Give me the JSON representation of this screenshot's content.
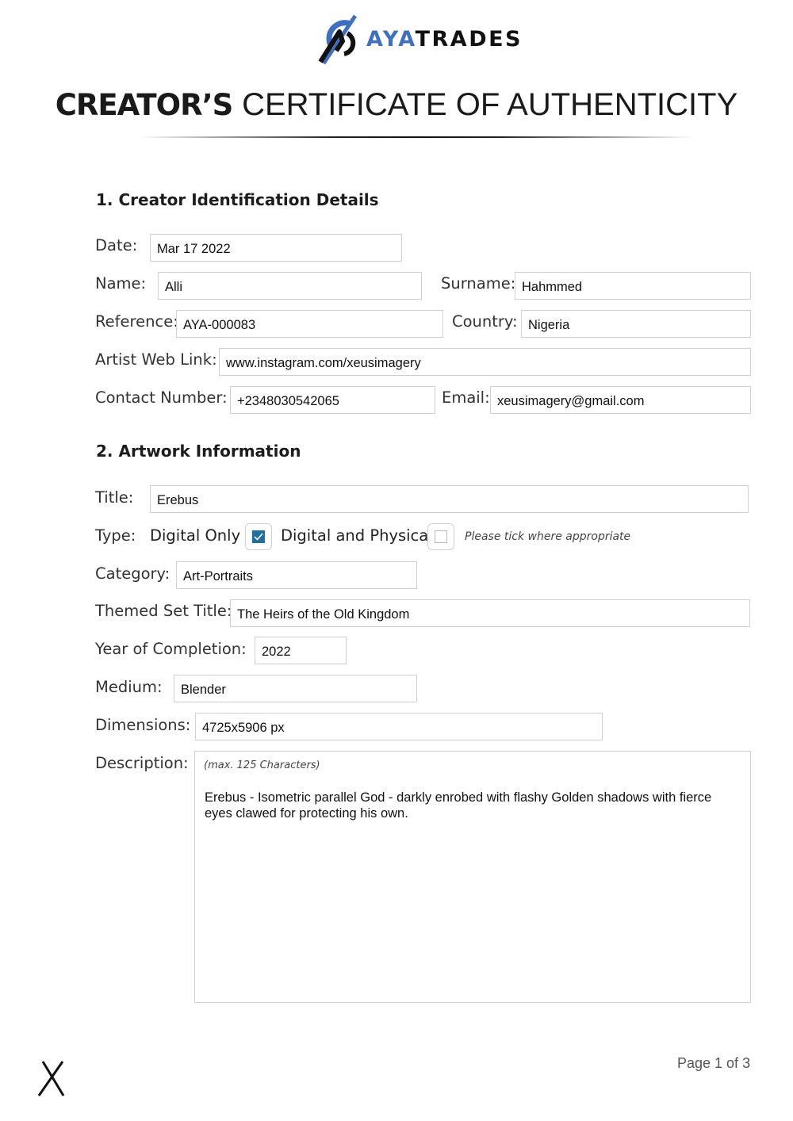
{
  "brand": {
    "name_part1": "AYA",
    "name_part2": "TRADES",
    "primary_color": "#3f6fbf",
    "secondary_color": "#111111",
    "logo_icon": "aya-trades-logo-icon"
  },
  "document": {
    "title_bold": "CREATOR’S",
    "title_light": "CERTIFICATE OF AUTHENTICITY"
  },
  "section1": {
    "heading": "1. Creator Identification Details",
    "date": {
      "label": "Date:",
      "value": "Mar 17 2022"
    },
    "name": {
      "label": "Name:",
      "value": "Alli"
    },
    "surname": {
      "label": "Surname:",
      "value": "Hahmmed"
    },
    "reference": {
      "label": "Reference:",
      "value": "AYA-000083"
    },
    "country": {
      "label": "Country:",
      "value": "Nigeria"
    },
    "web_link": {
      "label": "Artist Web Link:",
      "value": "www.instagram.com/xeusimagery"
    },
    "contact": {
      "label": "Contact Number:",
      "value": "+2348030542065"
    },
    "email": {
      "label": "Email:",
      "value": "xeusimagery@gmail.com"
    }
  },
  "section2": {
    "heading": "2. Artwork Information",
    "title": {
      "label": "Title:",
      "value": "Erebus"
    },
    "type": {
      "label": "Type:",
      "options": [
        {
          "label": "Digital Only",
          "checked": true
        },
        {
          "label": "Digital and Physical",
          "checked": false
        }
      ],
      "hint": "Please tick where appropriate",
      "check_color": "#1f6fa0"
    },
    "category": {
      "label": "Category:",
      "value": "Art-Portraits"
    },
    "themed_set": {
      "label": "Themed Set Title:",
      "value": "The Heirs of the Old Kingdom"
    },
    "year": {
      "label": "Year of Completion:",
      "value": "2022"
    },
    "medium": {
      "label": "Medium:",
      "value": "Blender"
    },
    "dimensions": {
      "label": "Dimensions:",
      "value": "4725x5906 px"
    },
    "description": {
      "label": "Description:",
      "hint": "(max. 125 Characters)",
      "value": "Erebus - Isometric parallel God - darkly enrobed with flashy Golden shadows with fierce eyes clawed for protecting his own."
    }
  },
  "footer": {
    "signature_mark": "X",
    "page_label": "Page 1 of 3"
  }
}
